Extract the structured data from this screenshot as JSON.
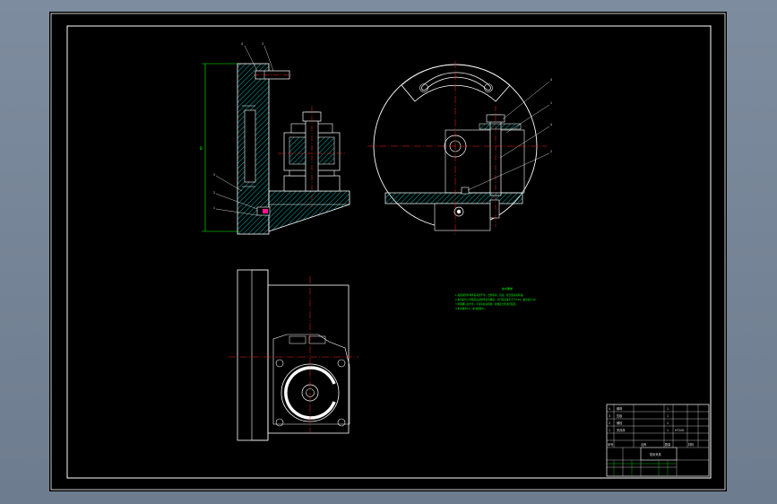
{
  "colors": {
    "background": "#7d8c9e",
    "sheet": "#000000",
    "line": "#ffffff",
    "centerline": "#ff2020",
    "hatch": "#00b3b3",
    "dimension": "#00ff00",
    "part_fill": "#007f7f"
  },
  "side_view": {
    "balloons": [
      "4",
      "3",
      "3",
      "2",
      "1"
    ],
    "dimension_label": "B"
  },
  "section_view": {
    "balloons": [
      "4",
      "1",
      "4",
      "2"
    ]
  },
  "tech_requirements": {
    "title": "技术要求",
    "lines": [
      "1.装配前所有零件需清洗干净，去除毛刺、锐边，配合面涂润滑油。",
      "2.夹具定位元件装配后应检查定位精度，平行度误差不大于0.02，垂直度0.02。",
      "3.紧固螺钉应拧紧，不得有松动现象，按规定力矩进行装配。",
      "4.未注倒角C1，未注圆角R1。"
    ]
  },
  "title_block": {
    "rows": [
      [
        "4",
        "螺母",
        "1",
        ""
      ],
      [
        "3",
        "压板",
        "1",
        ""
      ],
      [
        "2",
        "螺栓",
        "1",
        ""
      ],
      [
        "1",
        "夹具体",
        "1",
        "HT200"
      ]
    ],
    "header": [
      "序号",
      "名称",
      "数量",
      "材料"
    ],
    "name_cell": "铣床夹具",
    "drawing_no": ""
  }
}
